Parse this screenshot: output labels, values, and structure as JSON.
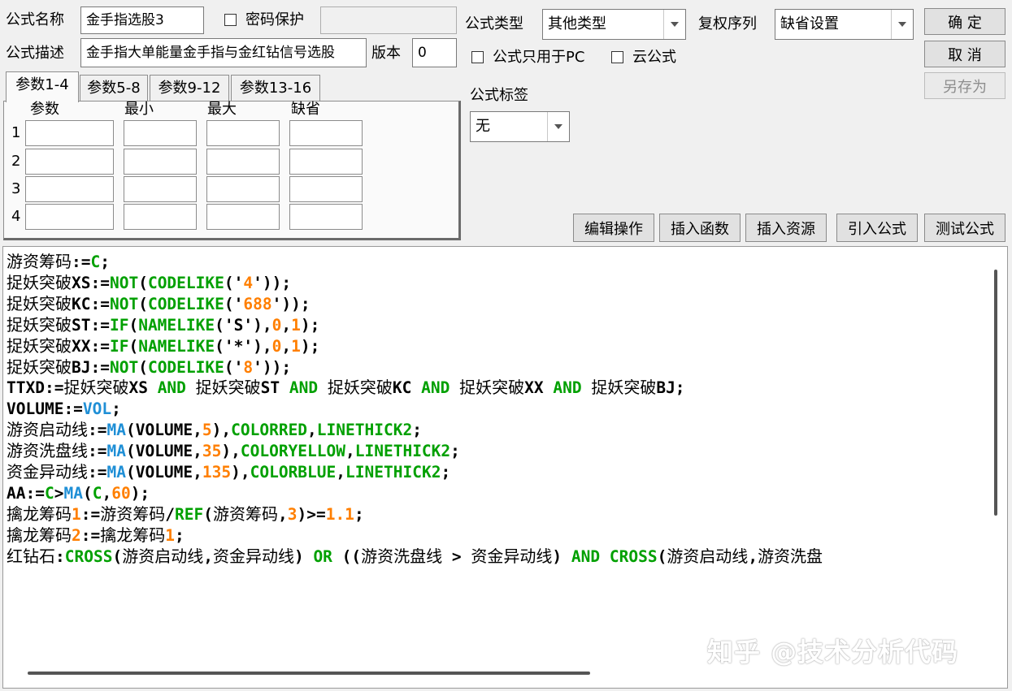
{
  "form": {
    "name_label": "公式名称",
    "name_value": "金手指选股3",
    "password_label": "密码保护",
    "desc_label": "公式描述",
    "desc_value": "金手指大单能量金手指与金红钻信号选股",
    "version_label": "版本",
    "version_value": "0",
    "type_label": "公式类型",
    "type_value": "其他类型",
    "rights_label": "复权序列",
    "rights_value": "缺省设置",
    "pc_only_label": "公式只用于PC",
    "cloud_label": "云公式",
    "tag_label": "公式标签",
    "tag_value": "无"
  },
  "buttons": {
    "ok": "确  定",
    "cancel": "取  消",
    "save_as": "另存为",
    "edit_ops": "编辑操作",
    "insert_func": "插入函数",
    "insert_res": "插入资源",
    "import_formula": "引入公式",
    "test_formula": "测试公式"
  },
  "param_tabs": [
    "参数1-4",
    "参数5-8",
    "参数9-12",
    "参数13-16"
  ],
  "param_headers": [
    "参数",
    "最小",
    "最大",
    "缺省"
  ],
  "param_rows": [
    "1",
    "2",
    "3",
    "4"
  ],
  "code_lines": [
    "游资筹码:=C;",
    "捉妖突破XS:=NOT(CODELIKE('4'));",
    "捉妖突破KC:=NOT(CODELIKE('688'));",
    "捉妖突破ST:=IF(NAMELIKE('S'),0,1);",
    "捉妖突破XX:=IF(NAMELIKE('*'),0,1);",
    "捉妖突破BJ:=NOT(CODELIKE('8'));",
    "TTXD:=捉妖突破XS AND 捉妖突破ST AND 捉妖突破KC AND 捉妖突破XX AND 捉妖突破BJ;",
    "VOLUME:=VOL;",
    "游资启动线:=MA(VOLUME,5),COLORRED,LINETHICK2;",
    "游资洗盘线:=MA(VOLUME,35),COLORYELLOW,LINETHICK2;",
    "资金异动线:=MA(VOLUME,135),COLORBLUE,LINETHICK2;",
    "AA:=C>MA(C,60);",
    "擒龙筹码1:=游资筹码/REF(游资筹码,3)>=1.1;",
    "擒龙筹码2:=擒龙筹码1;",
    "红钻石:CROSS(游资启动线,资金异动线) OR ((游资洗盘线 > 资金异动线) AND CROSS(游资启动线,游资洗盘"
  ],
  "watermark": "知乎 @技术分析代码"
}
